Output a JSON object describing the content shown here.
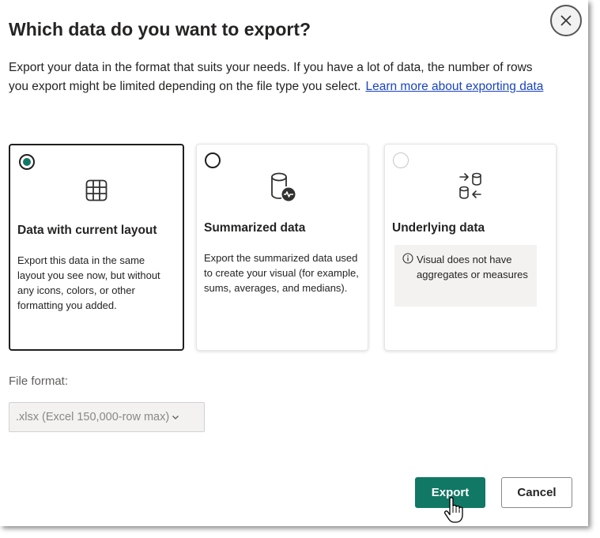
{
  "dialog": {
    "title": "Which data do you want to export?",
    "description": "Export your data in the format that suits your needs. If you have a lot of data, the number of rows you export might be limited depending on the file type you select.",
    "learn_more_link": "Learn more about exporting data",
    "close_icon": "close-icon"
  },
  "options": [
    {
      "title": "Data with current layout",
      "description": "Export this data in the same layout you see now, but without any icons, colors, or other formatting you added.",
      "icon": "table-icon",
      "state": "selected"
    },
    {
      "title": "Summarized data",
      "description": "Export the summarized data used to create your visual (for example, sums, averages, and medians).",
      "icon": "database-chart-icon",
      "state": "unselected"
    },
    {
      "title": "Underlying data",
      "info": "Visual does not have aggregates or measures",
      "icon": "database-swap-icon",
      "state": "disabled"
    }
  ],
  "file_format": {
    "label": "File format:",
    "value": ".xlsx (Excel 150,000-row max)"
  },
  "buttons": {
    "export": "Export",
    "cancel": "Cancel"
  },
  "colors": {
    "primary": "#117865",
    "text": "#252423",
    "link": "#1a44c2",
    "muted": "#605e5c"
  }
}
